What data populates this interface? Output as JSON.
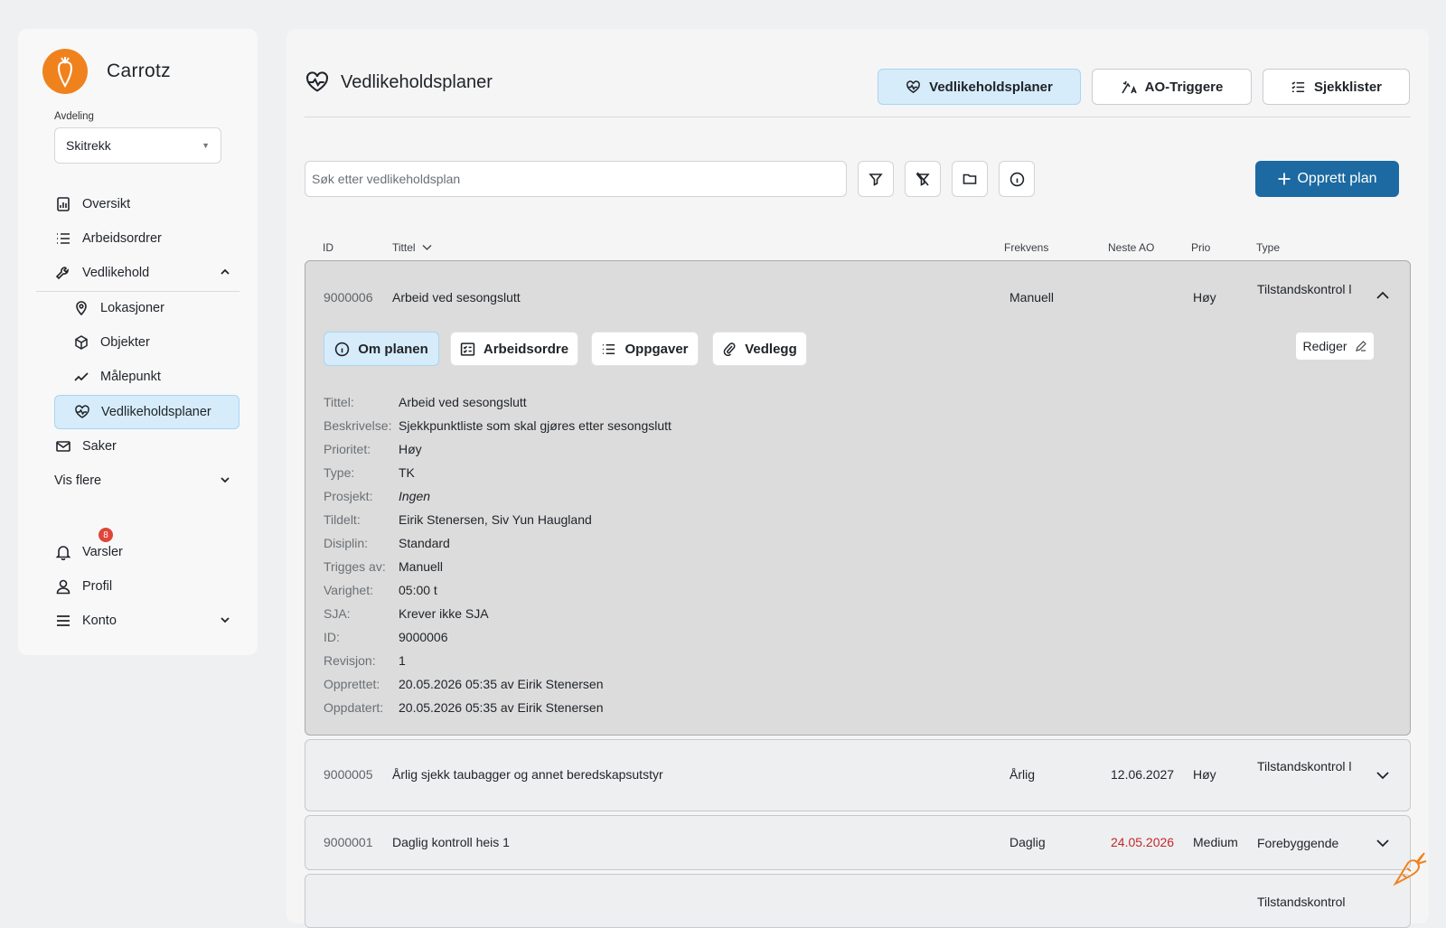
{
  "brand": {
    "name": "Carrotz",
    "logo_icon": "carrot-logo"
  },
  "department": {
    "label": "Avdeling",
    "value": "Skitrekk"
  },
  "nav": {
    "overview": "Oversikt",
    "workorders": "Arbeidsordrer",
    "maintenance": "Vedlikehold",
    "locations": "Lokasjoner",
    "objects": "Objekter",
    "measurepoint": "Målepunkt",
    "plans": "Vedlikeholdsplaner",
    "cases": "Saker",
    "more": "Vis flere",
    "alerts": "Varsler",
    "alerts_count": "8",
    "profile": "Profil",
    "account": "Konto"
  },
  "page": {
    "title": "Vedlikeholdsplaner",
    "tabs": {
      "plans": "Vedlikeholdsplaner",
      "triggers": "AO-Triggere",
      "checklists": "Sjekklister"
    }
  },
  "toolbar": {
    "search_placeholder": "Søk etter vedlikeholdsplan",
    "create_label": "Opprett plan"
  },
  "columns": {
    "id": "ID",
    "title": "Tittel",
    "frequency": "Frekvens",
    "next": "Neste AO",
    "prio": "Prio",
    "type": "Type"
  },
  "rows": [
    {
      "id": "9000006",
      "title": "Arbeid ved sesongslutt",
      "frequency": "Manuell",
      "next": "",
      "prio": "Høy",
      "type": "Tilstandskontrol l"
    },
    {
      "id": "9000005",
      "title": "Årlig sjekk taubagger og annet beredskapsutstyr",
      "frequency": "Årlig",
      "next": "12.06.2027",
      "prio": "Høy",
      "type": "Tilstandskontrol l"
    },
    {
      "id": "9000001",
      "title": "Daglig kontroll heis 1",
      "frequency": "Daglig",
      "next": "24.05.2026",
      "prio": "Medium",
      "type": "Forebyggende"
    },
    {
      "type": "Tilstandskontrol"
    }
  ],
  "expanded": {
    "tabs": {
      "about": "Om planen",
      "workorders": "Arbeidsordre",
      "tasks": "Oppgaver",
      "attachments": "Vedlegg"
    },
    "edit_label": "Rediger",
    "details": [
      {
        "label": "Tittel:",
        "value": "Arbeid ved sesongslutt"
      },
      {
        "label": "Beskrivelse:",
        "value": "Sjekkpunktliste som skal gjøres etter sesongslutt"
      },
      {
        "label": "Prioritet:",
        "value": "Høy"
      },
      {
        "label": "Type:",
        "value": "TK"
      },
      {
        "label": "Prosjekt:",
        "value": "Ingen"
      },
      {
        "label": "Tildelt:",
        "value": "Eirik  Stenersen, Siv Yun Haugland"
      },
      {
        "label": "Disiplin:",
        "value": "Standard"
      },
      {
        "label": "Trigges av:",
        "value": "Manuell"
      },
      {
        "label": "Varighet:",
        "value": "05:00 t"
      },
      {
        "label": "SJA:",
        "value": "Krever ikke SJA"
      },
      {
        "label": "ID:",
        "value": "9000006"
      },
      {
        "label": "Revisjon:",
        "value": "1"
      },
      {
        "label": "Opprettet:",
        "value": "20.05.2026 05:35 av Eirik Stenersen"
      },
      {
        "label": "Oppdatert:",
        "value": "20.05.2026 05:35 av Eirik Stenersen"
      }
    ]
  },
  "colors": {
    "accent": "#1c6aa1",
    "active_bg": "#d6ecfa",
    "logo": "#f0821e",
    "overdue": "#c2282f"
  }
}
